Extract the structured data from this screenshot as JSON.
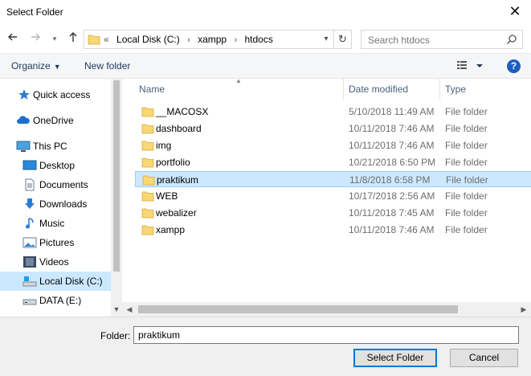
{
  "window": {
    "title": "Select Folder"
  },
  "address": {
    "crumbs": [
      "Local Disk (C:)",
      "xampp",
      "htdocs"
    ],
    "overflow_glyph": "«"
  },
  "search": {
    "placeholder": "Search htdocs"
  },
  "toolbar": {
    "organize_label": "Organize",
    "new_folder_label": "New folder",
    "help_label": "?"
  },
  "sidebar": {
    "items": [
      {
        "label": "Quick access",
        "icon": "star-icon"
      },
      {
        "label": "OneDrive",
        "icon": "cloud-icon"
      },
      {
        "label": "This PC",
        "icon": "computer-icon"
      },
      {
        "label": "Desktop",
        "icon": "desktop-icon"
      },
      {
        "label": "Documents",
        "icon": "documents-icon"
      },
      {
        "label": "Downloads",
        "icon": "download-icon"
      },
      {
        "label": "Music",
        "icon": "music-icon"
      },
      {
        "label": "Pictures",
        "icon": "pictures-icon"
      },
      {
        "label": "Videos",
        "icon": "videos-icon"
      },
      {
        "label": "Local Disk (C:)",
        "icon": "drive-icon",
        "selected": true
      },
      {
        "label": "DATA (E:)",
        "icon": "drive-icon"
      }
    ]
  },
  "columns": {
    "name": "Name",
    "date": "Date modified",
    "type": "Type"
  },
  "files": [
    {
      "name": "__MACOSX",
      "date": "5/10/2018 11:49 AM",
      "type": "File folder"
    },
    {
      "name": "dashboard",
      "date": "10/11/2018 7:46 AM",
      "type": "File folder"
    },
    {
      "name": "img",
      "date": "10/11/2018 7:46 AM",
      "type": "File folder"
    },
    {
      "name": "portfolio",
      "date": "10/21/2018 6:50 PM",
      "type": "File folder"
    },
    {
      "name": "praktikum",
      "date": "11/8/2018 6:58 PM",
      "type": "File folder",
      "selected": true
    },
    {
      "name": "WEB",
      "date": "10/17/2018 2:56 AM",
      "type": "File folder"
    },
    {
      "name": "webalizer",
      "date": "10/11/2018 7:45 AM",
      "type": "File folder"
    },
    {
      "name": "xampp",
      "date": "10/11/2018 7:46 AM",
      "type": "File folder"
    }
  ],
  "bottom": {
    "folder_label": "Folder:",
    "folder_value": "praktikum",
    "select_label": "Select Folder",
    "cancel_label": "Cancel"
  },
  "colors": {
    "selection": "#cce8ff",
    "selection_border": "#99d1ff",
    "accent": "#0078d7",
    "folder": "#f8d775"
  }
}
